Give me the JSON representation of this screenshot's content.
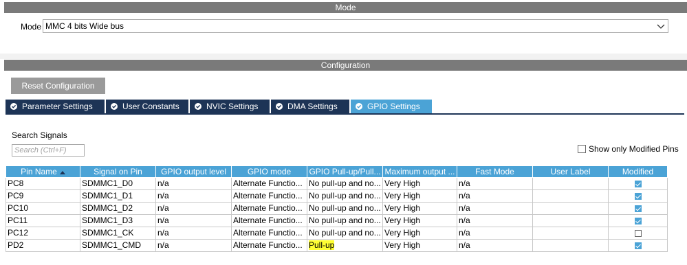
{
  "mode_section": {
    "title": "Mode",
    "mode_label": "Mode",
    "mode_value": "MMC 4 bits Wide bus"
  },
  "config_section": {
    "title": "Configuration",
    "reset_label": "Reset Configuration",
    "tabs": [
      {
        "label": "Parameter Settings",
        "active": false
      },
      {
        "label": "User Constants",
        "active": false
      },
      {
        "label": "NVIC Settings",
        "active": false
      },
      {
        "label": "DMA Settings",
        "active": false
      },
      {
        "label": "GPIO Settings",
        "active": true
      }
    ],
    "search_label": "Search Signals",
    "search_placeholder": "Search (Ctrl+F)",
    "show_modified_label": "Show only Modified Pins",
    "show_modified_checked": false
  },
  "table": {
    "columns": [
      "Pin Name",
      "Signal on Pin",
      "GPIO output level",
      "GPIO mode",
      "GPIO Pull-up/Pull...",
      "Maximum output ...",
      "Fast Mode",
      "User Label",
      "Modified"
    ],
    "rows": [
      {
        "pin": "PC8",
        "signal": "SDMMC1_D0",
        "level": "n/a",
        "mode": "Alternate Functio...",
        "pull": "No pull-up and no...",
        "speed": "Very High",
        "fast": "n/a",
        "label": "",
        "modified": true
      },
      {
        "pin": "PC9",
        "signal": "SDMMC1_D1",
        "level": "n/a",
        "mode": "Alternate Functio...",
        "pull": "No pull-up and no...",
        "speed": "Very High",
        "fast": "n/a",
        "label": "",
        "modified": true
      },
      {
        "pin": "PC10",
        "signal": "SDMMC1_D2",
        "level": "n/a",
        "mode": "Alternate Functio...",
        "pull": "No pull-up and no...",
        "speed": "Very High",
        "fast": "n/a",
        "label": "",
        "modified": true
      },
      {
        "pin": "PC11",
        "signal": "SDMMC1_D3",
        "level": "n/a",
        "mode": "Alternate Functio...",
        "pull": "No pull-up and no...",
        "speed": "Very High",
        "fast": "n/a",
        "label": "",
        "modified": true
      },
      {
        "pin": "PC12",
        "signal": "SDMMC1_CK",
        "level": "n/a",
        "mode": "Alternate Functio...",
        "pull": "No pull-up and no...",
        "speed": "Very High",
        "fast": "n/a",
        "label": "",
        "modified": false
      },
      {
        "pin": "PD2",
        "signal": "SDMMC1_CMD",
        "level": "n/a",
        "mode": "Alternate Functio...",
        "pull": "Pull-up",
        "speed": "Very High",
        "fast": "n/a",
        "label": "",
        "modified": true,
        "pull_highlight": true
      }
    ]
  },
  "colors": {
    "header_blue": "#4ba3d6",
    "tab_navy": "#1d3456",
    "section_grey": "#7a7a7a",
    "highlight": "#ffff33"
  },
  "icons": {
    "tab_icon": "check-circle-icon",
    "dropdown_icon": "chevron-down-icon",
    "sort_icon": "sort-asc-icon"
  }
}
